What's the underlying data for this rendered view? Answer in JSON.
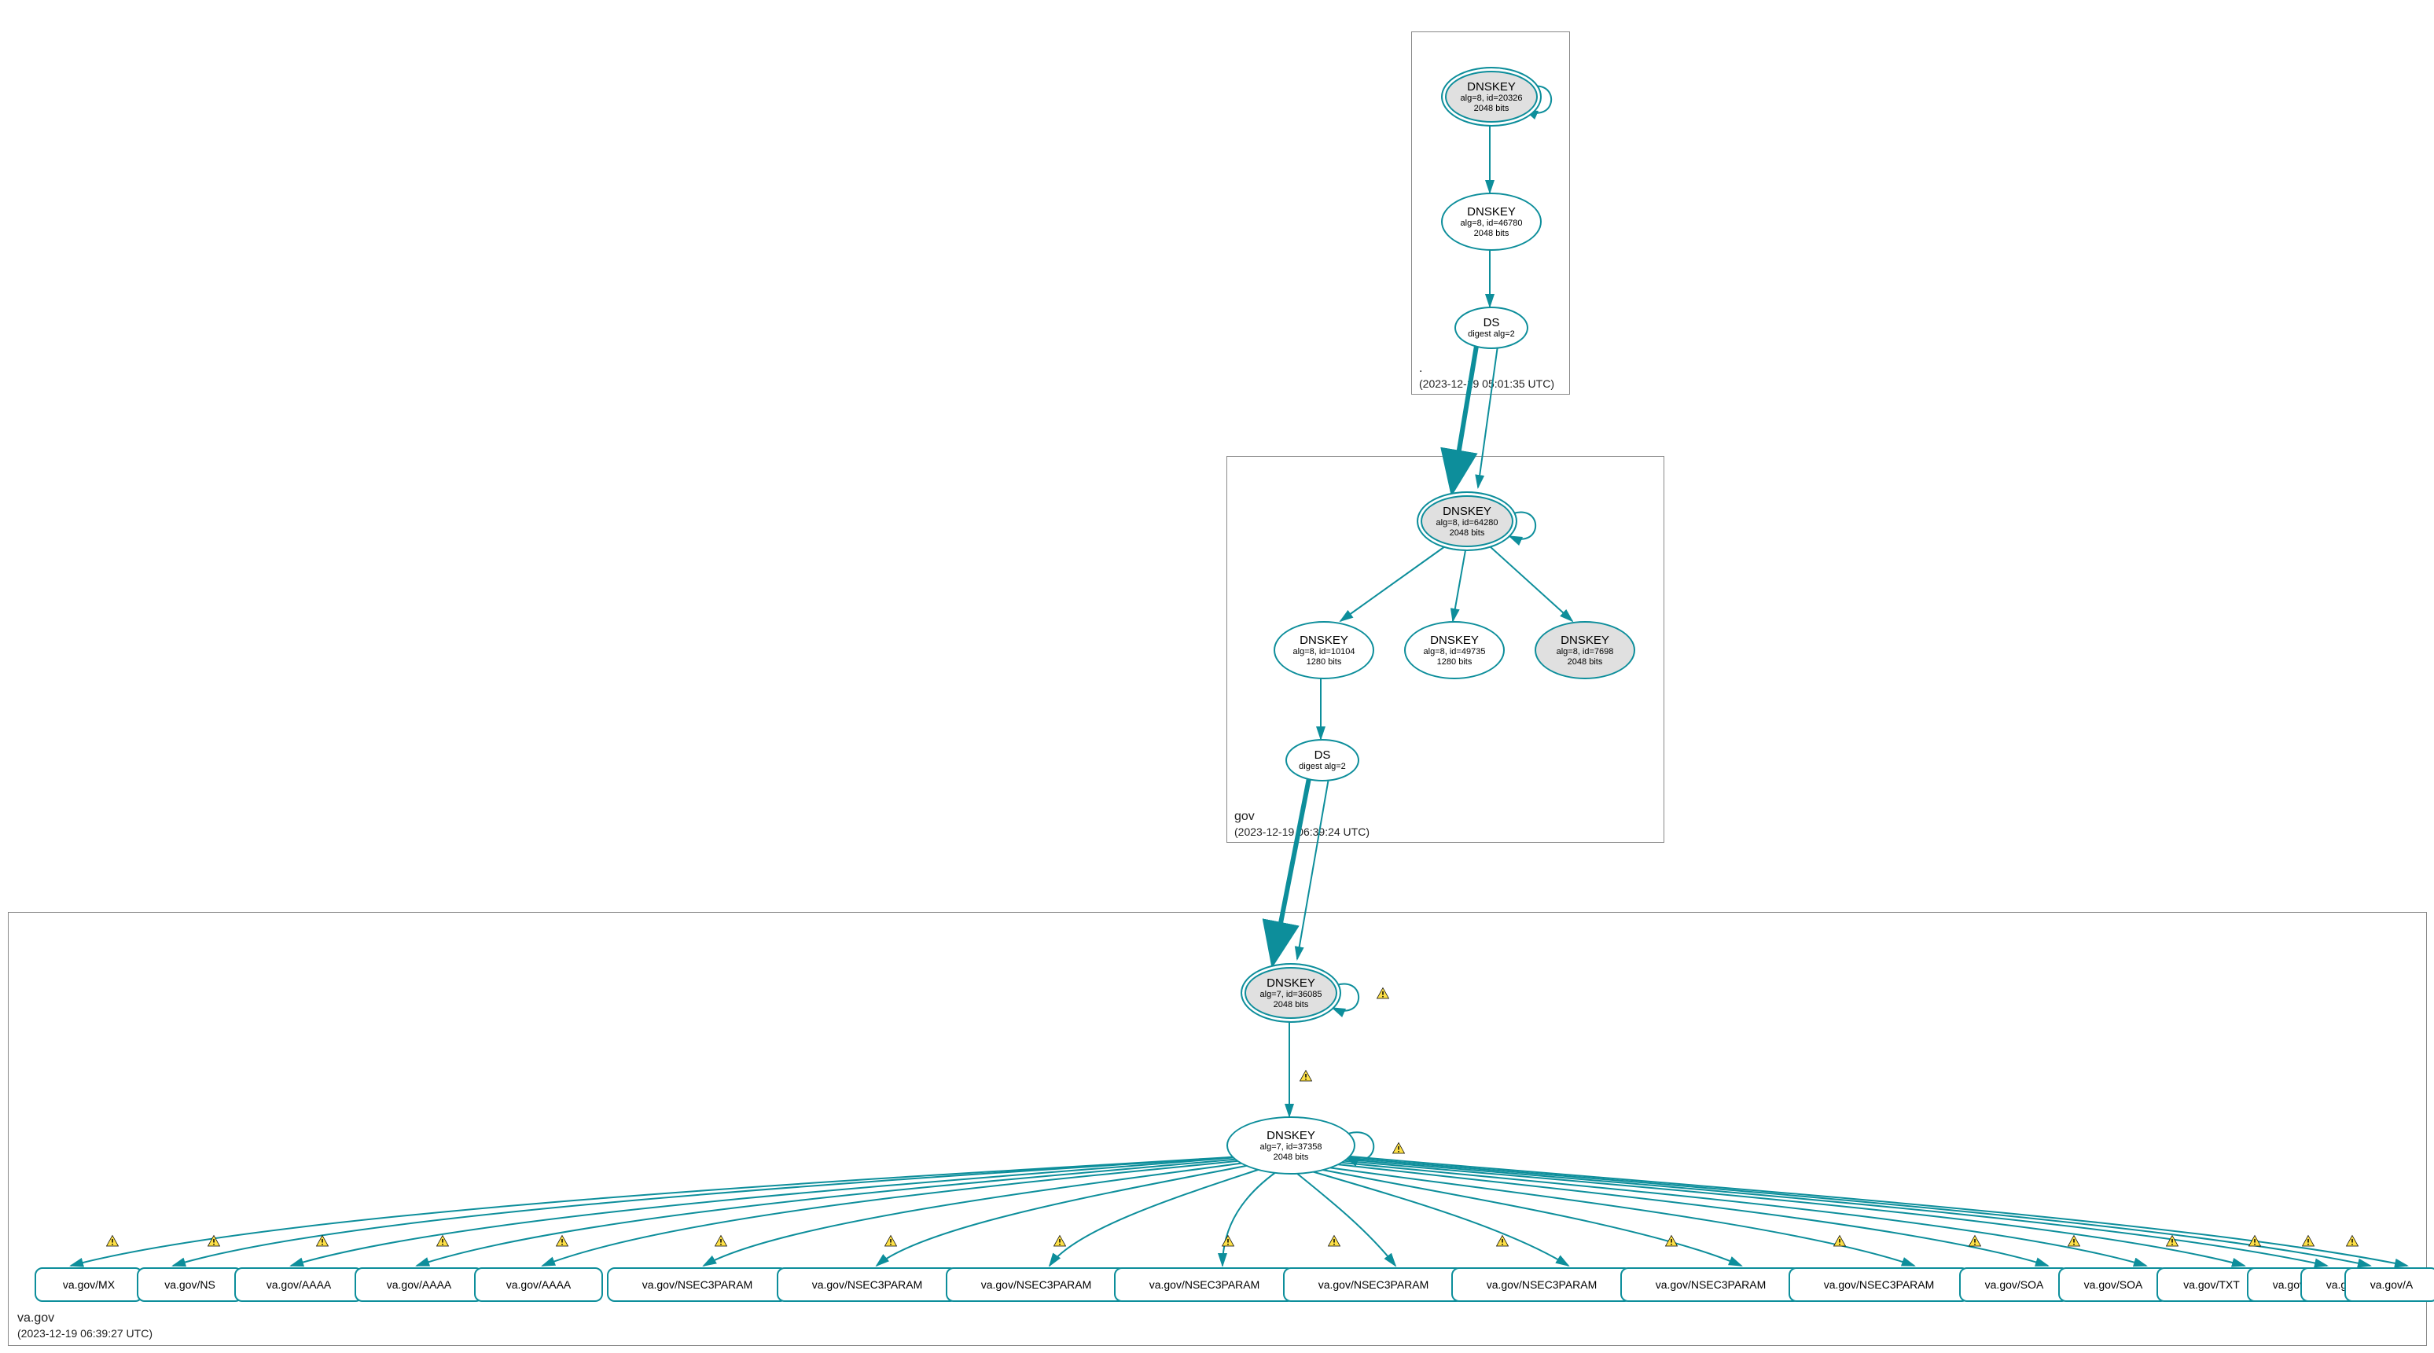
{
  "colors": {
    "stroke": "#0d8e9b",
    "kskFill": "#e0e0e0",
    "zoneBorder": "#888888",
    "warnFill": "#fde047",
    "warnStroke": "#000000"
  },
  "zones": {
    "root": {
      "label": ".",
      "timestamp": "(2023-12-19 05:01:35 UTC)"
    },
    "gov": {
      "label": "gov",
      "timestamp": "(2023-12-19 06:39:24 UTC)"
    },
    "vagov": {
      "label": "va.gov",
      "timestamp": "(2023-12-19 06:39:27 UTC)"
    }
  },
  "nodes": {
    "root_ksk": {
      "title": "DNSKEY",
      "line1": "alg=8, id=20326",
      "line2": "2048 bits"
    },
    "root_zsk": {
      "title": "DNSKEY",
      "line1": "alg=8, id=46780",
      "line2": "2048 bits"
    },
    "root_ds": {
      "title": "DS",
      "line1": "digest alg=2"
    },
    "gov_ksk": {
      "title": "DNSKEY",
      "line1": "alg=8, id=64280",
      "line2": "2048 bits"
    },
    "gov_zsk1": {
      "title": "DNSKEY",
      "line1": "alg=8, id=10104",
      "line2": "1280 bits"
    },
    "gov_zsk2": {
      "title": "DNSKEY",
      "line1": "alg=8, id=49735",
      "line2": "1280 bits"
    },
    "gov_zsk3": {
      "title": "DNSKEY",
      "line1": "alg=8, id=7698",
      "line2": "2048 bits"
    },
    "gov_ds": {
      "title": "DS",
      "line1": "digest alg=2"
    },
    "vagov_ksk": {
      "title": "DNSKEY",
      "line1": "alg=7, id=36085",
      "line2": "2048 bits"
    },
    "vagov_zsk": {
      "title": "DNSKEY",
      "line1": "alg=7, id=37358",
      "line2": "2048 bits"
    }
  },
  "leaves": [
    "va.gov/MX",
    "va.gov/NS",
    "va.gov/AAAA",
    "va.gov/AAAA",
    "va.gov/AAAA",
    "va.gov/NSEC3PARAM",
    "va.gov/NSEC3PARAM",
    "va.gov/NSEC3PARAM",
    "va.gov/NSEC3PARAM",
    "va.gov/NSEC3PARAM",
    "va.gov/NSEC3PARAM",
    "va.gov/NSEC3PARAM",
    "va.gov/NSEC3PARAM",
    "va.gov/SOA",
    "va.gov/SOA",
    "va.gov/TXT",
    "va.gov/A",
    "va.gov/A",
    "va.gov/A"
  ]
}
